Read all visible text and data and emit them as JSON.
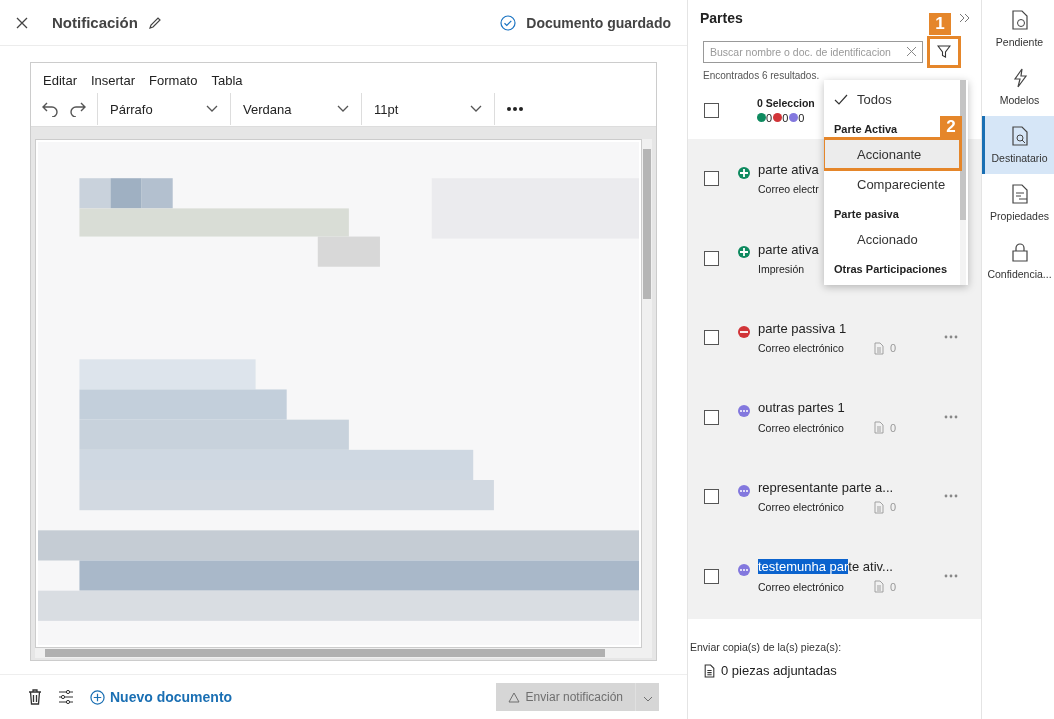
{
  "editor": {
    "title": "Notificación",
    "status": "Documento guardado",
    "menu": [
      "Editar",
      "Insertar",
      "Formato",
      "Tabla"
    ],
    "toolbar": {
      "block": "Párrafo",
      "font": "Verdana",
      "size": "11pt"
    },
    "document": {
      "kind": "picture"
    },
    "footer": {
      "new_document": "Nuevo documento",
      "send": {
        "label": "Enviar notificación",
        "disabled": true
      }
    }
  },
  "parties": {
    "title": "Partes",
    "search": {
      "placeholder": "Buscar nombre o doc. de identificacion",
      "callout": "1"
    },
    "results": "Encontrados 6 resultados.",
    "summary": {
      "label": "0 Seleccion",
      "checked": false,
      "counts": [
        {
          "kind": "active",
          "value": "0"
        },
        {
          "kind": "passive",
          "value": "0"
        },
        {
          "kind": "other",
          "value": "0"
        }
      ]
    },
    "rows": [
      {
        "kind": "active",
        "checked": false,
        "name": "parte ativa",
        "channel": "Correo electr"
      },
      {
        "kind": "active",
        "checked": false,
        "name": "parte ativa",
        "channel": "Impresión"
      },
      {
        "kind": "passive",
        "checked": false,
        "name": "parte passiva 1",
        "channel": "Correo electrónico",
        "docs": "0"
      },
      {
        "kind": "other",
        "checked": false,
        "name": "outras partes 1",
        "channel": "Correo electrónico",
        "docs": "0"
      },
      {
        "kind": "other",
        "checked": false,
        "name": "representante parte a...",
        "channel": "Correo electrónico",
        "docs": "0"
      },
      {
        "kind": "other",
        "checked": false,
        "name": "te ativ...",
        "highlighted": "testemunha par",
        "channel": "Correo electrónico",
        "docs": "0"
      }
    ],
    "filter_menu": [
      {
        "kind": "option",
        "label": "Todos",
        "checked": true,
        "hovered": false
      },
      {
        "kind": "header",
        "label": "Parte Activa"
      },
      {
        "kind": "option",
        "label": "Accionante",
        "checked": false,
        "hovered": true,
        "callout": "2"
      },
      {
        "kind": "option",
        "label": "Compareciente",
        "checked": false,
        "hovered": false
      },
      {
        "kind": "header",
        "label": "Parte pasiva"
      },
      {
        "kind": "option",
        "label": "Accionado",
        "checked": false,
        "hovered": false
      },
      {
        "kind": "header",
        "label": "Otras Participaciones"
      }
    ],
    "copies_label": "Enviar copia(s) de la(s) pieza(s):",
    "attachments": "0 piezas adjuntadas"
  },
  "rail": [
    {
      "kind": "pending",
      "label": "Pendiente",
      "selected": false
    },
    {
      "kind": "templates",
      "label": "Modelos",
      "selected": false
    },
    {
      "kind": "recipients",
      "label": "Destinatario",
      "selected": true
    },
    {
      "kind": "properties",
      "label": "Propiedades",
      "selected": false
    },
    {
      "kind": "lock",
      "label": "Confidencia...",
      "selected": false
    }
  ]
}
